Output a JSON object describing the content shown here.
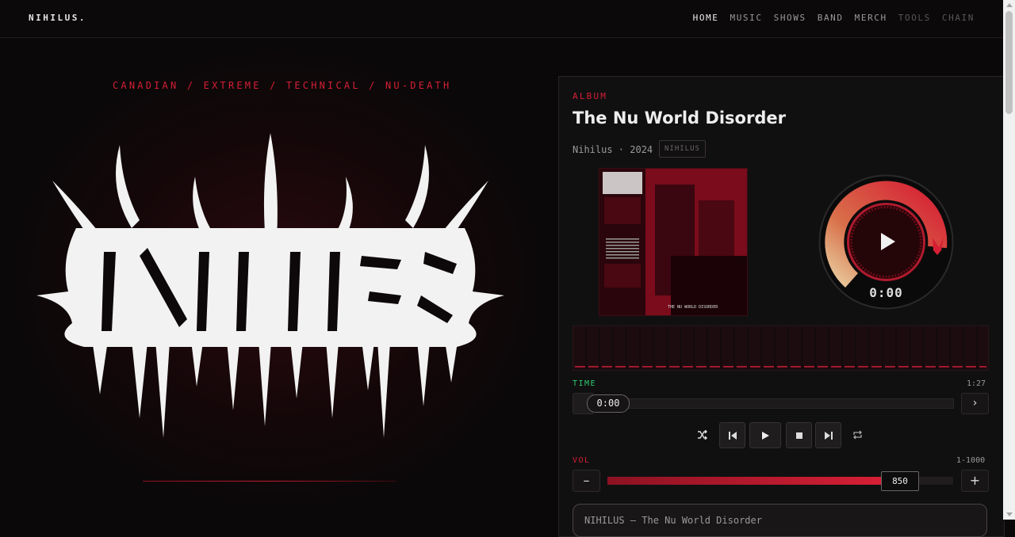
{
  "nav": {
    "brand": "NIHILUS.",
    "links": [
      {
        "label": "HOME",
        "state": "active"
      },
      {
        "label": "MUSIC",
        "state": "normal"
      },
      {
        "label": "SHOWS",
        "state": "normal"
      },
      {
        "label": "BAND",
        "state": "normal"
      },
      {
        "label": "MERCH",
        "state": "normal"
      },
      {
        "label": "TOOLS",
        "state": "dim"
      },
      {
        "label": "CHAIN",
        "state": "dim"
      }
    ]
  },
  "hero": {
    "tagline": "CANADIAN / EXTREME / TECHNICAL / NU-DEATH",
    "logo_alt": "Nihilus band logo"
  },
  "player": {
    "kind": "ALBUM",
    "title": "The Nu World Disorder",
    "artist_year": "Nihilus · 2024",
    "badge": "NIHILUS",
    "cover_text": "THE NU WORLD DISORDER",
    "dial_time": "0:00",
    "time_label": "TIME",
    "time_total": "1:27",
    "time_current": "0:00",
    "next_symbol": "›",
    "vol_label": "VOL",
    "vol_range": "1-1000",
    "vol_value": "850",
    "vol_fraction": 0.85,
    "vol_minus": "–",
    "vol_plus": "+",
    "now_playing": "NIHILUS – The Nu World Disorder"
  },
  "icons": {
    "shuffle": "shuffle-icon",
    "prev": "skip-back-icon",
    "play": "play-icon",
    "stop": "stop-icon",
    "next": "skip-forward-icon",
    "repeat": "repeat-icon"
  },
  "colors": {
    "accent": "#d61f35",
    "time_label": "#2ecc71",
    "background": "#0a0809"
  }
}
